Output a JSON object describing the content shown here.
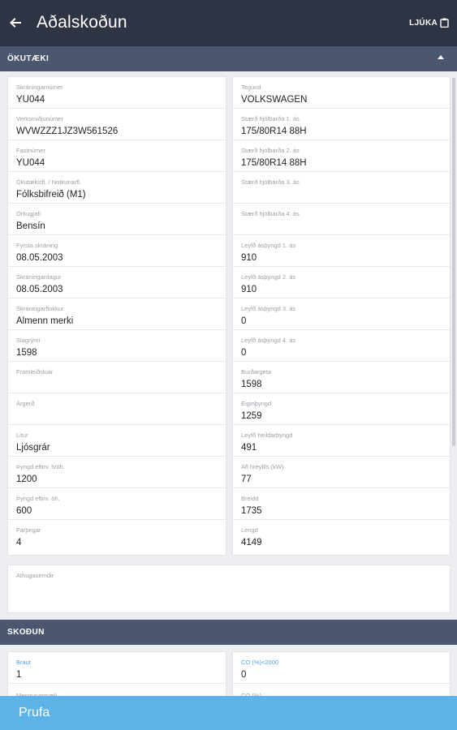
{
  "header": {
    "title": "Aðalskoðun",
    "action_label": "LJÚKA",
    "back_icon": "arrow-back-icon",
    "action_icon": "clipboard-icon"
  },
  "section_vehicle": {
    "label": "ÖKUTÆKI",
    "toggle_icon": "collapse-caret-icon"
  },
  "vehicle_left": [
    {
      "label": "Skráningarnúmer",
      "value": "YU044"
    },
    {
      "label": "Verksmiðjunúmer",
      "value": "WVWZZZ1JZ3W561526"
    },
    {
      "label": "Fastnúmer",
      "value": "YU044"
    },
    {
      "label": "Ökutækisfl. / Notkunarfl.",
      "value": "Fólksbifreið (M1)"
    },
    {
      "label": "Orkugjafi",
      "value": "Bensín"
    },
    {
      "label": "Fyrsta skráning",
      "value": "08.05.2003"
    },
    {
      "label": "Skráningardagur",
      "value": "08.05.2003"
    },
    {
      "label": "Skráningarflokkur",
      "value": "Almenn merki"
    },
    {
      "label": "Slagrými",
      "value": "1598"
    },
    {
      "label": "Framleiðsluár",
      "value": ""
    },
    {
      "label": "Árgerð",
      "value": ""
    },
    {
      "label": "Litur",
      "value": "Ljósgrár"
    },
    {
      "label": "Þyngd eftirv. h/öh.",
      "value": "1200"
    },
    {
      "label": "Þyngd eftirv. öh.",
      "value": "600"
    },
    {
      "label": "Farþegar",
      "value": "4"
    }
  ],
  "vehicle_right": [
    {
      "label": "Tegund",
      "value": "VOLKSWAGEN"
    },
    {
      "label": "Stærð hjólbarða 1. ás",
      "value": "175/80R14 88H"
    },
    {
      "label": "Stærð hjólbarða 2. ás",
      "value": "175/80R14 88H"
    },
    {
      "label": "Stærð hjólbarða 3. ás",
      "value": ""
    },
    {
      "label": "Stærð hjólbarða 4. ás",
      "value": ""
    },
    {
      "label": "Leyfð ásþyngd 1. ás",
      "value": "910"
    },
    {
      "label": "Leyfð ásþyngd 2. ás",
      "value": "910"
    },
    {
      "label": "Leyfð ásþyngd 3. ás",
      "value": "0"
    },
    {
      "label": "Leyfð ásþyngd 4. ás",
      "value": "0"
    },
    {
      "label": "Burðargeta",
      "value": "1598"
    },
    {
      "label": "Eiginþyngd",
      "value": "1259"
    },
    {
      "label": "Leyfð heildarþyngd",
      "value": "491"
    },
    {
      "label": "Afl hreyfils (kW)",
      "value": "77"
    },
    {
      "label": "Breidd",
      "value": "1735"
    },
    {
      "label": "Lengd",
      "value": "4149"
    }
  ],
  "remarks": {
    "label": "Athugasemdir",
    "value": ""
  },
  "section_inspection": {
    "label": "SKOÐUN"
  },
  "inspection": [
    {
      "label": "Braut",
      "value": "1"
    },
    {
      "label": "CO (%)<2000",
      "value": "0"
    },
    {
      "label": "Mengunarmæli",
      "value": ""
    },
    {
      "label": "CO (%)",
      "value": ""
    }
  ],
  "bottom": {
    "label": "Prufa"
  },
  "colors": {
    "appbar": "#2e3443",
    "section": "#4b5670",
    "accent": "#5bb3e8",
    "link_label": "#4a9fde"
  }
}
